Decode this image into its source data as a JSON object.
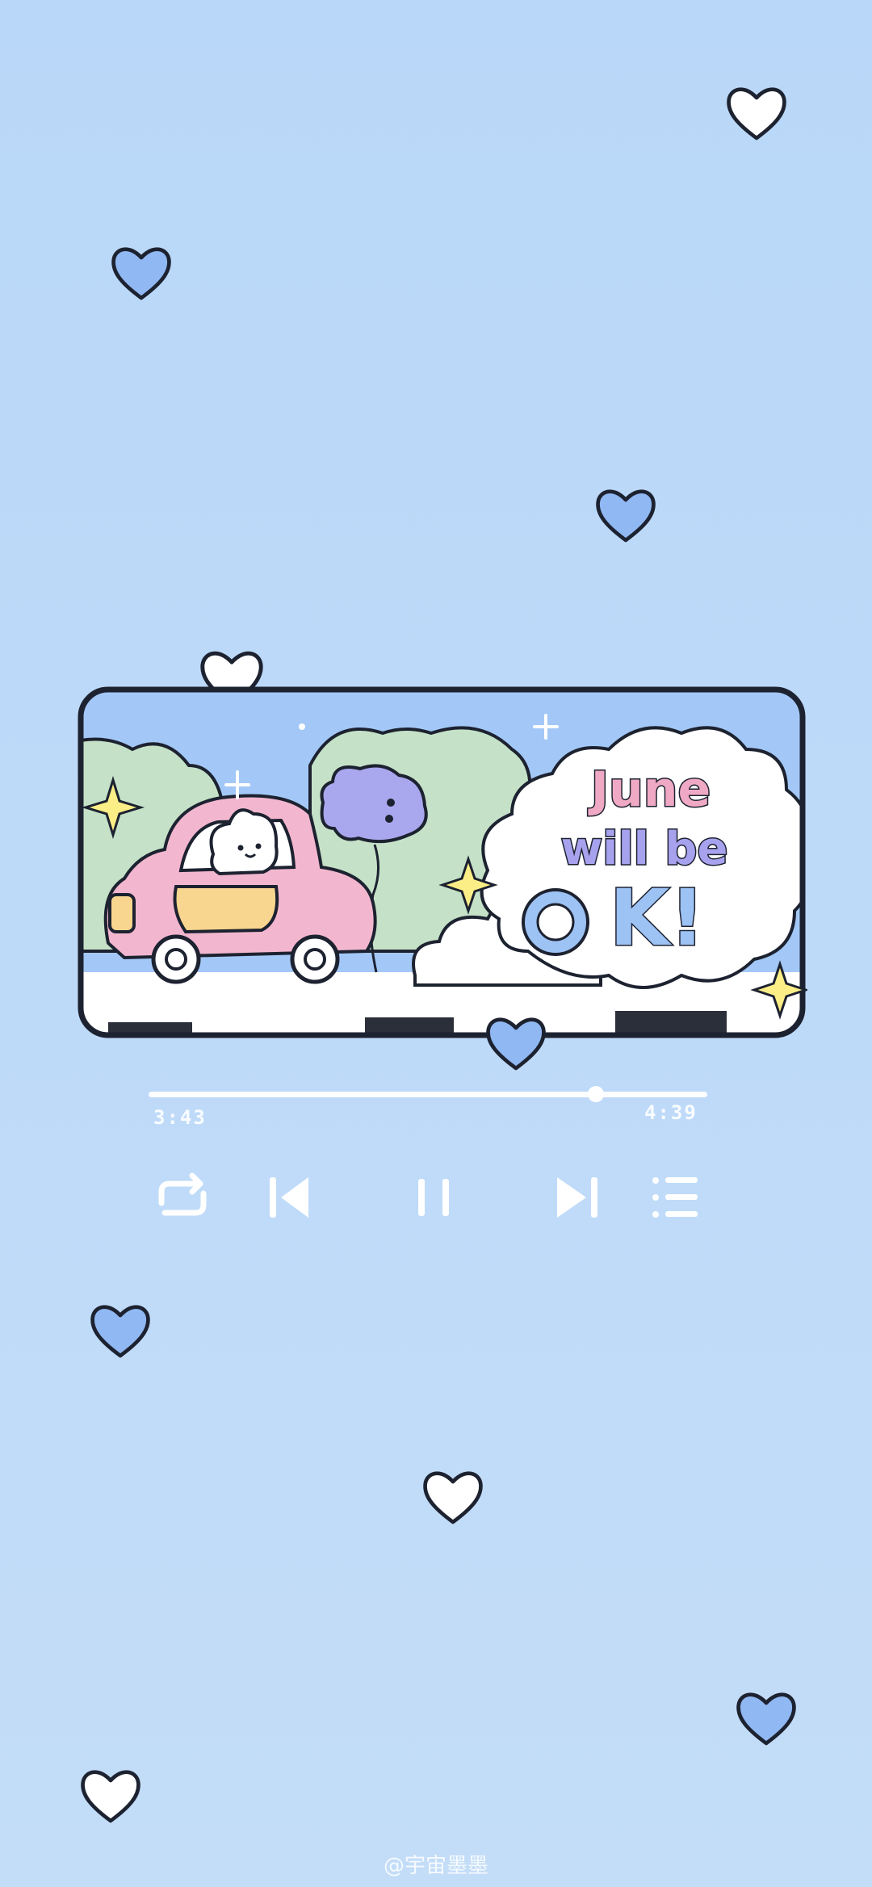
{
  "wallpaper": {
    "card_text": {
      "line1": "June",
      "line2": "will be",
      "line3_letter_k": "K!"
    },
    "colors": {
      "background": "#bcd9f8",
      "heart_blue": "#90b8f2",
      "heart_white": "#ffffff",
      "outline": "#1d2230",
      "car_pink": "#f2b7cf",
      "text_pink": "#f0a9c4",
      "text_purple": "#a7a2ee",
      "text_blue": "#9dc2f4",
      "star_yellow": "#fbee87"
    }
  },
  "player": {
    "elapsed": "3:43",
    "duration": "4:39",
    "progress": 0.8
  },
  "controls": {
    "repeat_icon": "repeat-icon",
    "previous_icon": "skip-previous-icon",
    "pause_icon": "pause-icon",
    "next_icon": "skip-next-icon",
    "playlist_icon": "playlist-icon"
  },
  "watermark": "@宇宙墨墨"
}
